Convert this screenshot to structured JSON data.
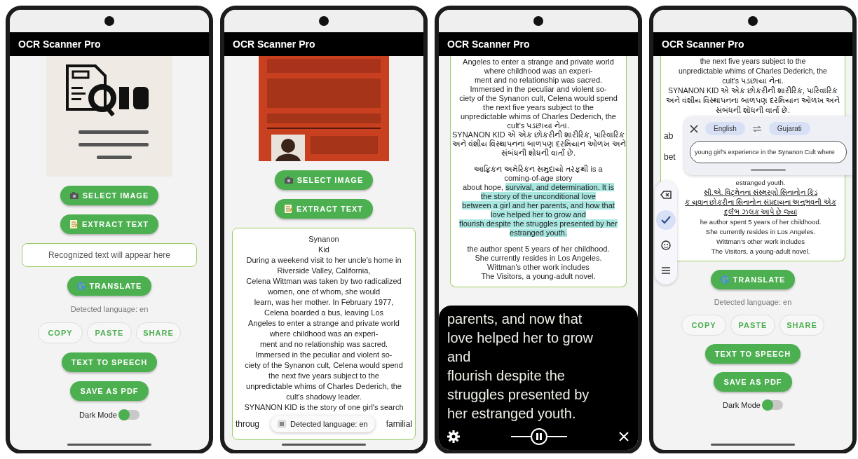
{
  "phones": [
    {
      "kind": "home",
      "title": "OCR Scanner Pro",
      "image": {
        "kind": "picture"
      },
      "select_button": "SELECT IMAGE",
      "extract_button": "EXTRACT TEXT",
      "result_field": {
        "placeholder": "Recognized text will appear here"
      },
      "translate_button": "TRANSLATE",
      "detected_language": "Detected language: en",
      "actions": [
        "COPY",
        "PASTE",
        "SHARE"
      ],
      "speech_button": "TEXT TO SPEECH",
      "pdf_button": "SAVE AS PDF",
      "dark_mode": {
        "label": "Dark Mode",
        "on": false
      }
    },
    {
      "kind": "result",
      "title": "OCR Scanner Pro",
      "image": {
        "kind": "picture"
      },
      "select_button": "SELECT IMAGE",
      "extract_button": "EXTRACT TEXT",
      "lines": [
        {
          "text": "Synanon"
        },
        {
          "text": "Kid"
        },
        {
          "text": "During a weekend visit to her uncle's home in"
        },
        {
          "text": "Riverside Valley, California,"
        },
        {
          "text": "Celena Wittman was taken by two radicalized"
        },
        {
          "text": "women, one of whom, she would"
        },
        {
          "text": "learn, was her mother. In February 1977,"
        },
        {
          "text": "Celena boarded a bus, leaving Los"
        },
        {
          "text": "Angeles to enter a strange and private world"
        },
        {
          "text": "where childhood was an experi-"
        },
        {
          "text": "ment and no relationship was sacred."
        },
        {
          "text": "Immersed in the peculiar and violent so-"
        },
        {
          "text": "ciety of the Synanon cult, Celena would spend"
        },
        {
          "text": "the next five years subject to the"
        },
        {
          "text": "unpredictable whims of Charles Dederich, the"
        },
        {
          "text": "cult's shadowy leader."
        },
        {
          "text": "SYNANON KID is the story of one girl's search"
        }
      ],
      "last_line": [
        "throug",
        "familial"
      ],
      "toast": "Detected language: en"
    },
    {
      "kind": "reader",
      "title": "OCR Scanner Pro",
      "paragraphs": [
        {
          "lines": [
            {
              "text": "Angeles to enter a strange and private world",
              "highlighted": false
            },
            {
              "text": "where childhood was an experi-",
              "highlighted": false
            },
            {
              "text": "ment and no relationship was sacred.",
              "highlighted": false
            },
            {
              "text": "Immersed in the peculiar and violent so-",
              "highlighted": false
            },
            {
              "text": "ciety of the Synanon cult, Celena would spend",
              "highlighted": false
            },
            {
              "text": "the next five years subject to the",
              "highlighted": false
            },
            {
              "text": "unpredictable whims of Charles Dederich, the",
              "highlighted": false
            },
            {
              "text": "cult's પડછાયા નેતા.",
              "highlighted": false
            },
            {
              "text": "SYNANON KID એ એક છોકરીની શારીરિક, પારિવારિક",
              "highlighted": false
            },
            {
              "text": "અને વંશીય વિસ્થાપનના બાળપણ દરમિયાન ઓળખ અને",
              "highlighted": false
            },
            {
              "text": "સંબંધની શોધની વાર્તા છે.",
              "highlighted": false
            }
          ]
        },
        {
          "lines": [
            {
              "text": "આફ્રિકન અમેરિકન સમુદાયો તરફથી is a",
              "highlighted": false
            },
            {
              "text": "coming-of-age story",
              "highlighted": false
            },
            {
              "parts": [
                {
                  "text": "about hope, ",
                  "highlighted": false
                },
                {
                  "text": "survival, and determination. It is",
                  "highlighted": true
                }
              ]
            },
            {
              "text": "the story of the unconditional love",
              "highlighted": true
            },
            {
              "text": "between a girl and her parents, and how that",
              "highlighted": true
            },
            {
              "text": "love helped her to grow and",
              "highlighted": true
            },
            {
              "text": "flourish despite the struggles presented by her",
              "highlighted": true
            },
            {
              "text": "estranged youth.",
              "highlighted": true
            }
          ]
        },
        {
          "lines": [
            {
              "text": "the author spent 5 years of her childhood.",
              "highlighted": false
            },
            {
              "text": "She currently resides in Los Angeles.",
              "highlighted": false
            },
            {
              "text": "Wittman's other work includes",
              "highlighted": false
            },
            {
              "text": "The Visitors, a young-adult novel.",
              "highlighted": false
            }
          ]
        }
      ],
      "caption": [
        "parents, and now that",
        "love helped her to grow",
        "and",
        "flourish despite the",
        "struggles presented by",
        "her estranged youth."
      ]
    },
    {
      "kind": "translate",
      "title": "OCR Scanner Pro",
      "lines_top": [
        {
          "text": "the next five years subject to the"
        },
        {
          "text": "unpredictable whims of Charles Dederich, the"
        },
        {
          "text": "cult's પડછાયા નેતા."
        },
        {
          "text": "SYNANON KID એ એક છોકરીની શારીરિક, પારિવારિક"
        },
        {
          "text": "અને વંશીય વિસ્થાપનના બાળપણ દરમિયાન ઓળખ અને"
        },
        {
          "text": "સંબંધની શોધની વાર્તા છે."
        }
      ],
      "fragments": [
        "ab",
        "bet"
      ],
      "lines_bottom": [
        {
          "text": "estranged youth.",
          "underlined": false
        },
        {
          "text": "સી.એ. વિટ્મેનના સંસ્મરણો સિનાનોન કિડ",
          "underlined": true
        },
        {
          "text": "ક યુવાન છોકરીના સિનાનોન સંપ્રદાયના અનુભવની એક",
          "underlined": true
        },
        {
          "text": "દુર્લભ ઝલક આપે છે જ્યાં",
          "underlined": true
        },
        {
          "text": "he author spent 5 years of her childhood.",
          "underlined": false
        },
        {
          "text": "She currently resides in Los Angeles.",
          "underlined": false
        },
        {
          "text": "Wittman's other work includes",
          "underlined": false
        },
        {
          "text": "The Visitors, a young-adult novel.",
          "underlined": false
        }
      ],
      "popup": {
        "source": "English",
        "target": "Gujarati",
        "value": "young girl's experience in the Synanon Cult where"
      },
      "keyboard_tools": [
        {
          "selected": false
        },
        {
          "selected": true
        },
        {
          "selected": false
        },
        {
          "selected": false
        }
      ],
      "translate_button": "TRANSLATE",
      "detected_language": "Detected language: en",
      "actions": [
        "COPY",
        "PASTE",
        "SHARE"
      ],
      "speech_button": "TEXT TO SPEECH",
      "pdf_button": "SAVE AS PDF",
      "dark_mode": {
        "label": "Dark Mode",
        "on": false
      }
    }
  ]
}
